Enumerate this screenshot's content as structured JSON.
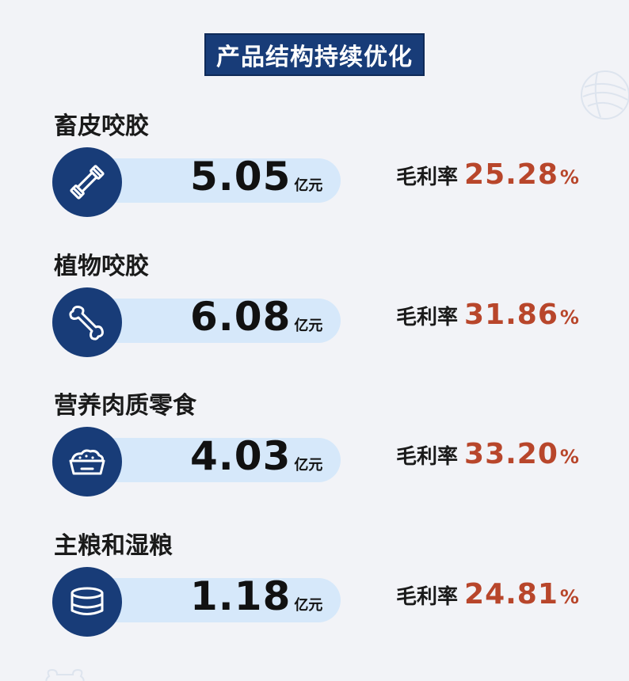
{
  "title": "产品结构持续优化",
  "margin_label": "毛利率",
  "unit": "亿元",
  "percent_sign": "%",
  "colors": {
    "background": "#f2f3f7",
    "navy": "#183c78",
    "pill": "#d6e8fa",
    "accent": "#b8462b"
  },
  "categories": [
    {
      "label": "畜皮咬胶",
      "revenue": "5.05",
      "margin": "25.28",
      "icon": "chew-stick-icon"
    },
    {
      "label": "植物咬胶",
      "revenue": "6.08",
      "margin": "31.86",
      "icon": "bone-icon"
    },
    {
      "label": "营养肉质零食",
      "revenue": "4.03",
      "margin": "33.20",
      "icon": "food-bowl-icon"
    },
    {
      "label": "主粮和湿粮",
      "revenue": "1.18",
      "margin": "24.81",
      "icon": "wet-food-can-icon"
    }
  ]
}
